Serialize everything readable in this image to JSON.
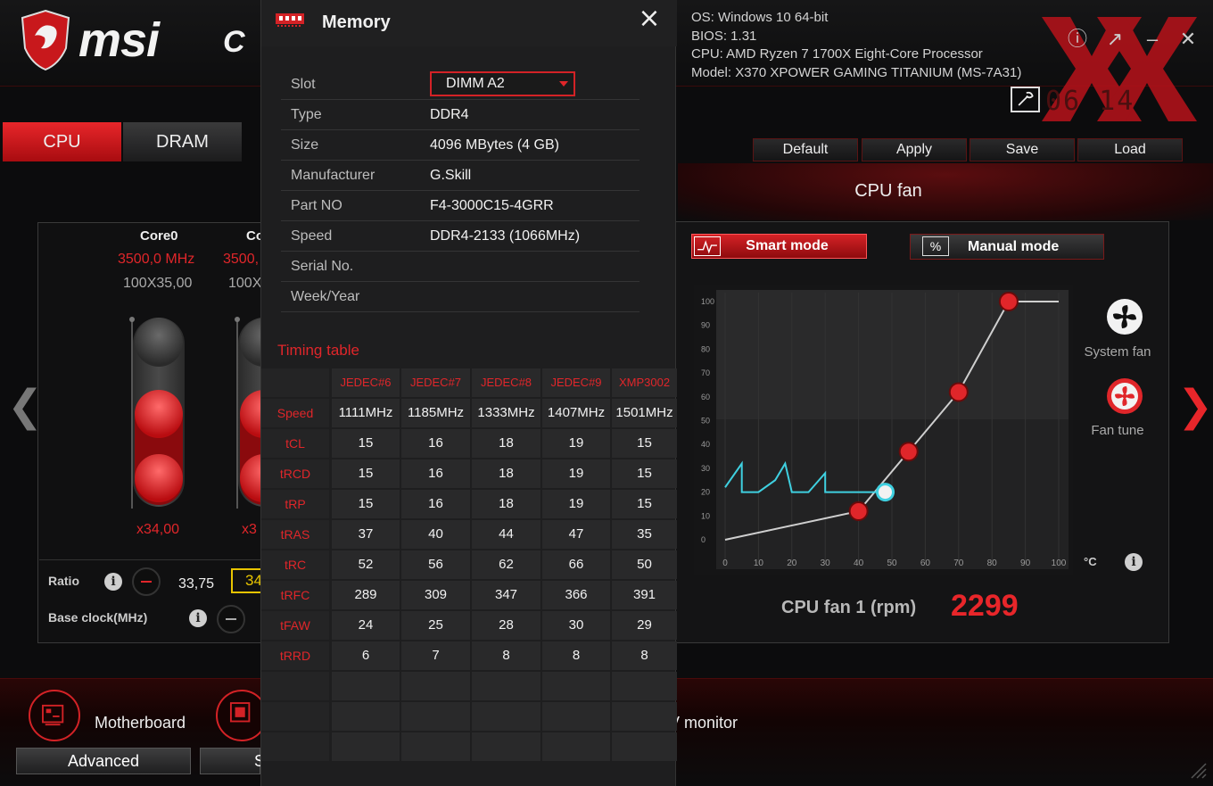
{
  "app": {
    "logo_text": "msi",
    "logo_suffix": "C",
    "sysinfo": [
      "OS: Windows 10 64-bit",
      "BIOS: 1.31",
      "CPU: AMD Ryzen 7 1700X Eight-Core Processor",
      "Model: X370 XPOWER GAMING TITANIUM (MS-7A31)"
    ],
    "clock": "06 14",
    "tabs": [
      "CPU",
      "DRAM"
    ],
    "actions": [
      "Default",
      "Apply",
      "Save",
      "Load"
    ],
    "cores": [
      {
        "name": "Core0",
        "mhz": "3500,0 MHz",
        "mult": "100X35,00",
        "ratio": "x34,00"
      },
      {
        "name": "Co",
        "mhz": "3500,",
        "mult": "100X",
        "ratio": "x3"
      }
    ],
    "ratio_label": "Ratio",
    "ratio_value": "33,75",
    "ratio_box": "34",
    "base_clock_label": "Base clock(MHz)",
    "fan": {
      "title": "CPU fan",
      "smart_mode": "Smart mode",
      "manual_mode": "Manual mode",
      "manual_icon": "%",
      "system_fan": "System fan",
      "fan_tune": "Fan tune",
      "unit": "°C",
      "rpm_label": "CPU fan 1 (rpm)",
      "rpm_value": "2299"
    },
    "bottom": {
      "motherboard": "Motherboard",
      "hw_monitor": "V monitor",
      "advanced": "Advanced",
      "second_button": "S"
    }
  },
  "memory": {
    "title": "Memory",
    "close": "×",
    "rows": [
      {
        "label": "Slot",
        "value": "DIMM A2"
      },
      {
        "label": "Type",
        "value": "DDR4"
      },
      {
        "label": "Size",
        "value": "4096 MBytes (4 GB)"
      },
      {
        "label": "Manufacturer",
        "value": "G.Skill"
      },
      {
        "label": "Part NO",
        "value": "F4-3000C15-4GRR"
      },
      {
        "label": "Speed",
        "value": "DDR4-2133 (1066MHz)"
      },
      {
        "label": "Serial No.",
        "value": ""
      },
      {
        "label": "Week/Year",
        "value": ""
      }
    ],
    "timing_title": "Timing table",
    "timing_columns": [
      "JEDEC#6",
      "JEDEC#7",
      "JEDEC#8",
      "JEDEC#9",
      "XMP3002"
    ],
    "timing_rows": [
      {
        "label": "Speed",
        "values": [
          "1111MHz",
          "1185MHz",
          "1333MHz",
          "1407MHz",
          "1501MHz"
        ]
      },
      {
        "label": "tCL",
        "values": [
          "15",
          "16",
          "18",
          "19",
          "15"
        ]
      },
      {
        "label": "tRCD",
        "values": [
          "15",
          "16",
          "18",
          "19",
          "15"
        ]
      },
      {
        "label": "tRP",
        "values": [
          "15",
          "16",
          "18",
          "19",
          "15"
        ]
      },
      {
        "label": "tRAS",
        "values": [
          "37",
          "40",
          "44",
          "47",
          "35"
        ]
      },
      {
        "label": "tRC",
        "values": [
          "52",
          "56",
          "62",
          "66",
          "50"
        ]
      },
      {
        "label": "tRFC",
        "values": [
          "289",
          "309",
          "347",
          "366",
          "391"
        ]
      },
      {
        "label": "tFAW",
        "values": [
          "24",
          "25",
          "28",
          "30",
          "29"
        ]
      },
      {
        "label": "tRRD",
        "values": [
          "6",
          "7",
          "8",
          "8",
          "8"
        ]
      },
      {
        "label": "",
        "values": [
          "",
          "",
          "",
          "",
          ""
        ]
      },
      {
        "label": "",
        "values": [
          "",
          "",
          "",
          "",
          ""
        ]
      },
      {
        "label": "",
        "values": [
          "",
          "",
          "",
          "",
          ""
        ]
      }
    ]
  },
  "chart_data": {
    "type": "line",
    "x_ticks": [
      "0",
      "10",
      "20",
      "30",
      "40",
      "50",
      "60",
      "70",
      "80",
      "90",
      "100"
    ],
    "y_ticks": [
      "0",
      "10",
      "20",
      "30",
      "40",
      "50",
      "60",
      "70",
      "80",
      "90",
      "100"
    ],
    "xlim": [
      0,
      100
    ],
    "ylim": [
      0,
      100
    ],
    "series": [
      {
        "x": [
          0,
          40,
          55,
          70,
          85,
          100
        ],
        "y": [
          0,
          12,
          37,
          62,
          100,
          100
        ],
        "color": "#cfcfcf"
      },
      {
        "x": [
          0,
          5,
          5,
          10,
          15,
          18,
          20,
          25,
          30,
          30,
          35,
          48
        ],
        "y": [
          22,
          32,
          20,
          20,
          25,
          32,
          20,
          20,
          28,
          20,
          20,
          20
        ],
        "color": "#3fd0e0"
      }
    ],
    "control_points": [
      {
        "x": 40,
        "y": 12
      },
      {
        "x": 55,
        "y": 37
      },
      {
        "x": 70,
        "y": 62
      },
      {
        "x": 85,
        "y": 100
      }
    ],
    "current_point": {
      "x": 48,
      "y": 20
    },
    "colors": {
      "accent": "#e0262a",
      "curve": "#cfcfcf",
      "temp": "#3fd0e0"
    }
  }
}
